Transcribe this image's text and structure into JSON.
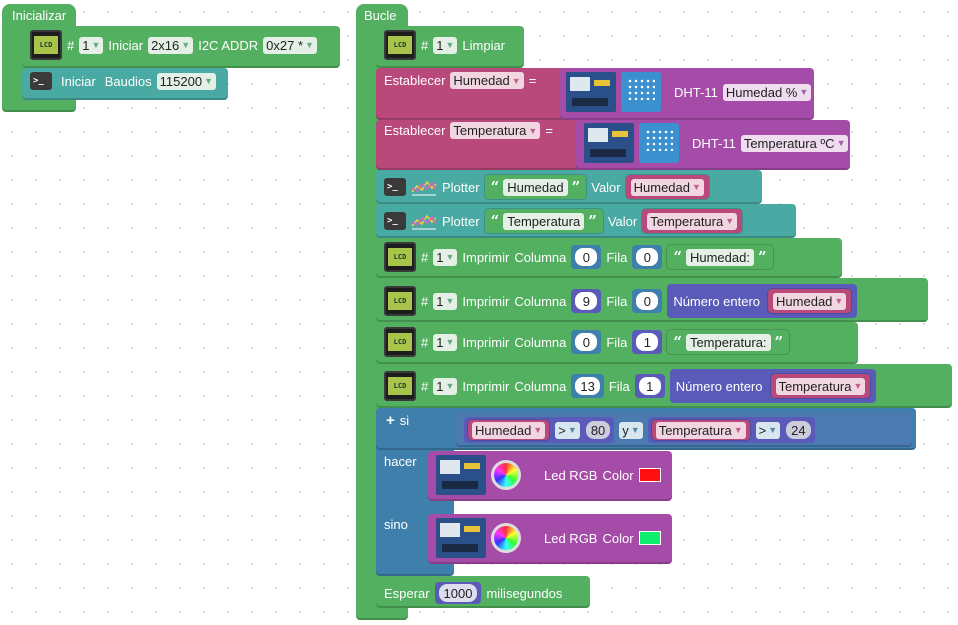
{
  "init": {
    "title": "Inicializar",
    "lcd_hash": "#",
    "lcd_num": "1",
    "lcd_iniciar": "Iniciar",
    "lcd_size": "2x16",
    "lcd_i2c": "I2C ADDR",
    "lcd_addr": "0x27 *",
    "serial_iniciar": "Iniciar",
    "serial_baud_label": "Baudios",
    "serial_baud": "115200",
    "lcd_icon_text": "LCD"
  },
  "loop": {
    "title": "Bucle",
    "hash": "#",
    "num": "1",
    "limpiar": "Limpiar",
    "establecer": "Establecer",
    "eq": "=",
    "dht": "DHT-11",
    "var_humedad": "Humedad",
    "var_temperatura": "Temperatura",
    "dht_hum_opt": "Humedad %",
    "dht_temp_opt": "Temperatura ºC",
    "plotter": "Plotter",
    "valor": "Valor",
    "str_humedad": "Humedad",
    "str_temperatura": "Temperatura",
    "imprimir": "Imprimir",
    "columna": "Columna",
    "fila": "Fila",
    "numero_entero": "Número entero",
    "str_humedad_label": "Humedad:",
    "str_temperatura_label": "Temperatura:",
    "print_rows": [
      {
        "col": "0",
        "fila": "0"
      },
      {
        "col": "9",
        "fila": "0"
      },
      {
        "col": "0",
        "fila": "1"
      },
      {
        "col": "13",
        "fila": "1"
      }
    ],
    "si": "si",
    "hacer": "hacer",
    "sino": "sino",
    "plus": "+",
    "op_gt": ">",
    "and": "y",
    "threshold_hum": "80",
    "threshold_temp": "24",
    "led_rgb": "Led RGB",
    "color": "Color",
    "color_hacer": "#ff1010",
    "color_sino": "#10ee70",
    "esperar": "Esperar",
    "ms_value": "1000",
    "milisegundos": "milisegundos"
  }
}
